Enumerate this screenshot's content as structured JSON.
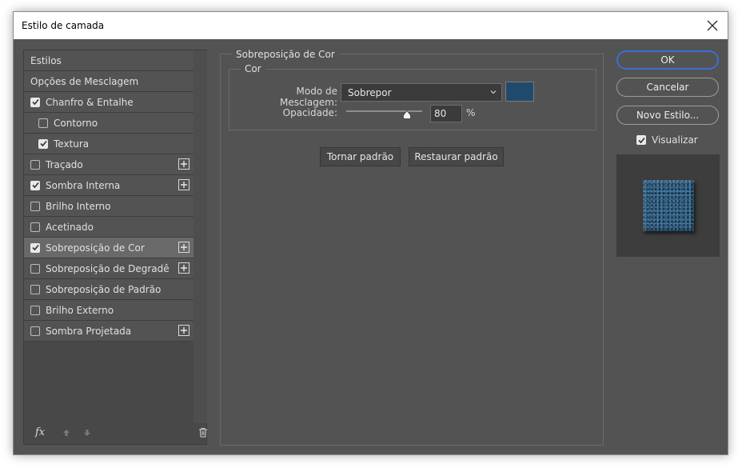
{
  "window": {
    "title": "Estilo de camada"
  },
  "left": {
    "items": [
      {
        "label": "Estilos",
        "checkbox": false,
        "checked": false,
        "plus": false,
        "indent": false,
        "selected": false
      },
      {
        "label": "Opções de Mesclagem",
        "checkbox": false,
        "checked": false,
        "plus": false,
        "indent": false,
        "selected": false
      },
      {
        "label": "Chanfro & Entalhe",
        "checkbox": true,
        "checked": true,
        "plus": false,
        "indent": false,
        "selected": false
      },
      {
        "label": "Contorno",
        "checkbox": true,
        "checked": false,
        "plus": false,
        "indent": true,
        "selected": false
      },
      {
        "label": "Textura",
        "checkbox": true,
        "checked": true,
        "plus": false,
        "indent": true,
        "selected": false
      },
      {
        "label": "Traçado",
        "checkbox": true,
        "checked": false,
        "plus": true,
        "indent": false,
        "selected": false
      },
      {
        "label": "Sombra Interna",
        "checkbox": true,
        "checked": true,
        "plus": true,
        "indent": false,
        "selected": false
      },
      {
        "label": "Brilho Interno",
        "checkbox": true,
        "checked": false,
        "plus": false,
        "indent": false,
        "selected": false
      },
      {
        "label": "Acetinado",
        "checkbox": true,
        "checked": false,
        "plus": false,
        "indent": false,
        "selected": false
      },
      {
        "label": "Sobreposição de Cor",
        "checkbox": true,
        "checked": true,
        "plus": true,
        "indent": false,
        "selected": true
      },
      {
        "label": "Sobreposição de Degradê",
        "checkbox": true,
        "checked": false,
        "plus": true,
        "indent": false,
        "selected": false
      },
      {
        "label": "Sobreposição de Padrão",
        "checkbox": true,
        "checked": false,
        "plus": false,
        "indent": false,
        "selected": false
      },
      {
        "label": "Brilho Externo",
        "checkbox": true,
        "checked": false,
        "plus": false,
        "indent": false,
        "selected": false
      },
      {
        "label": "Sombra Projetada",
        "checkbox": true,
        "checked": false,
        "plus": true,
        "indent": false,
        "selected": false
      }
    ],
    "footer": {
      "fx_label": "fx"
    }
  },
  "center": {
    "section_title": "Sobreposição de Cor",
    "group_title": "Cor",
    "blend_mode_label": "Modo de Mesclagem:",
    "blend_mode_value": "Sobrepor",
    "color_swatch": "#1f4a6b",
    "opacity_label": "Opacidade:",
    "opacity_value": "80",
    "opacity_unit": "%",
    "opacity_fraction": 0.8,
    "make_default_button": "Tornar padrão",
    "reset_default_button": "Restaurar padrão"
  },
  "right": {
    "ok_button": "OK",
    "cancel_button": "Cancelar",
    "new_style_button": "Novo Estilo...",
    "preview_label": "Visualizar",
    "preview_checked": true
  },
  "colors": {
    "dialog_bg": "#535353",
    "selected_item": "#696969",
    "primary_border": "#3a6ed6"
  }
}
